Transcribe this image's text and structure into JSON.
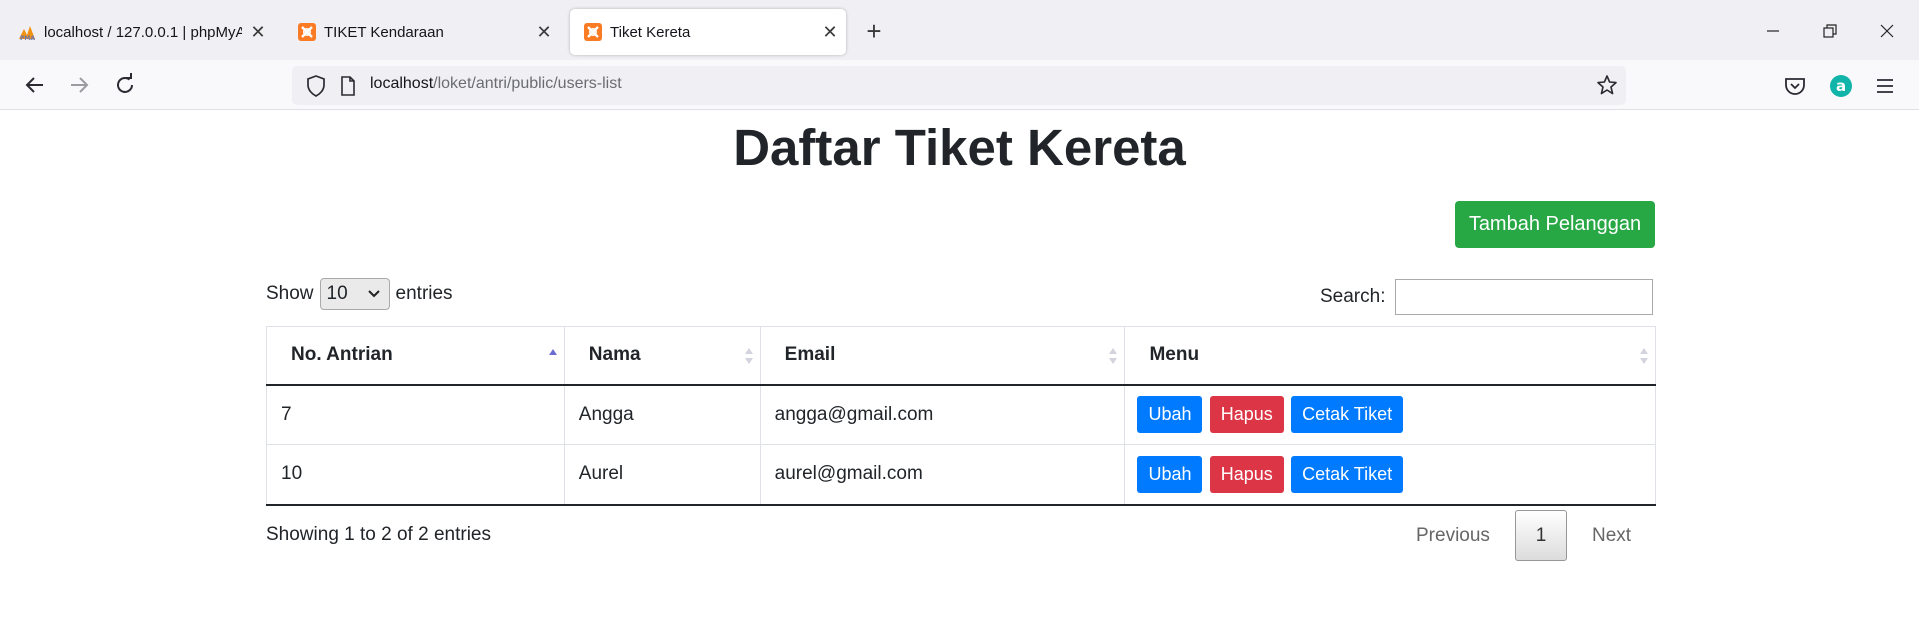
{
  "browser": {
    "tabs": [
      {
        "title": "localhost / 127.0.0.1 | phpMyAdmin",
        "icon": "phpmyadmin-icon",
        "active": false
      },
      {
        "title": "TIKET Kendaraan",
        "icon": "xampp-icon",
        "active": false
      },
      {
        "title": "Tiket Kereta",
        "icon": "xampp-icon",
        "active": true
      }
    ],
    "tab_close": "✕",
    "new_tab": "+",
    "url_host": "localhost",
    "url_path": "/loket/antri/public/users-list"
  },
  "page": {
    "title": "Daftar Tiket Kereta",
    "add_button": "Tambah Pelanggan",
    "show_label": "Show",
    "show_value": "10",
    "entries_label": "entries",
    "search_label": "Search:",
    "search_value": "",
    "table": {
      "headers": [
        "No. Antrian",
        "Nama",
        "Email",
        "Menu"
      ],
      "rows": [
        {
          "no": "7",
          "nama": "Angga",
          "email": "angga@gmail.com"
        },
        {
          "no": "10",
          "nama": "Aurel",
          "email": "aurel@gmail.com"
        }
      ],
      "actions": {
        "edit": "Ubah",
        "delete": "Hapus",
        "print": "Cetak Tiket"
      }
    },
    "info": "Showing 1 to 2 of 2 entries",
    "pagination": {
      "previous": "Previous",
      "current": "1",
      "next": "Next"
    }
  },
  "colors": {
    "success": "#28a745",
    "primary": "#007bff",
    "danger": "#dc3545"
  }
}
